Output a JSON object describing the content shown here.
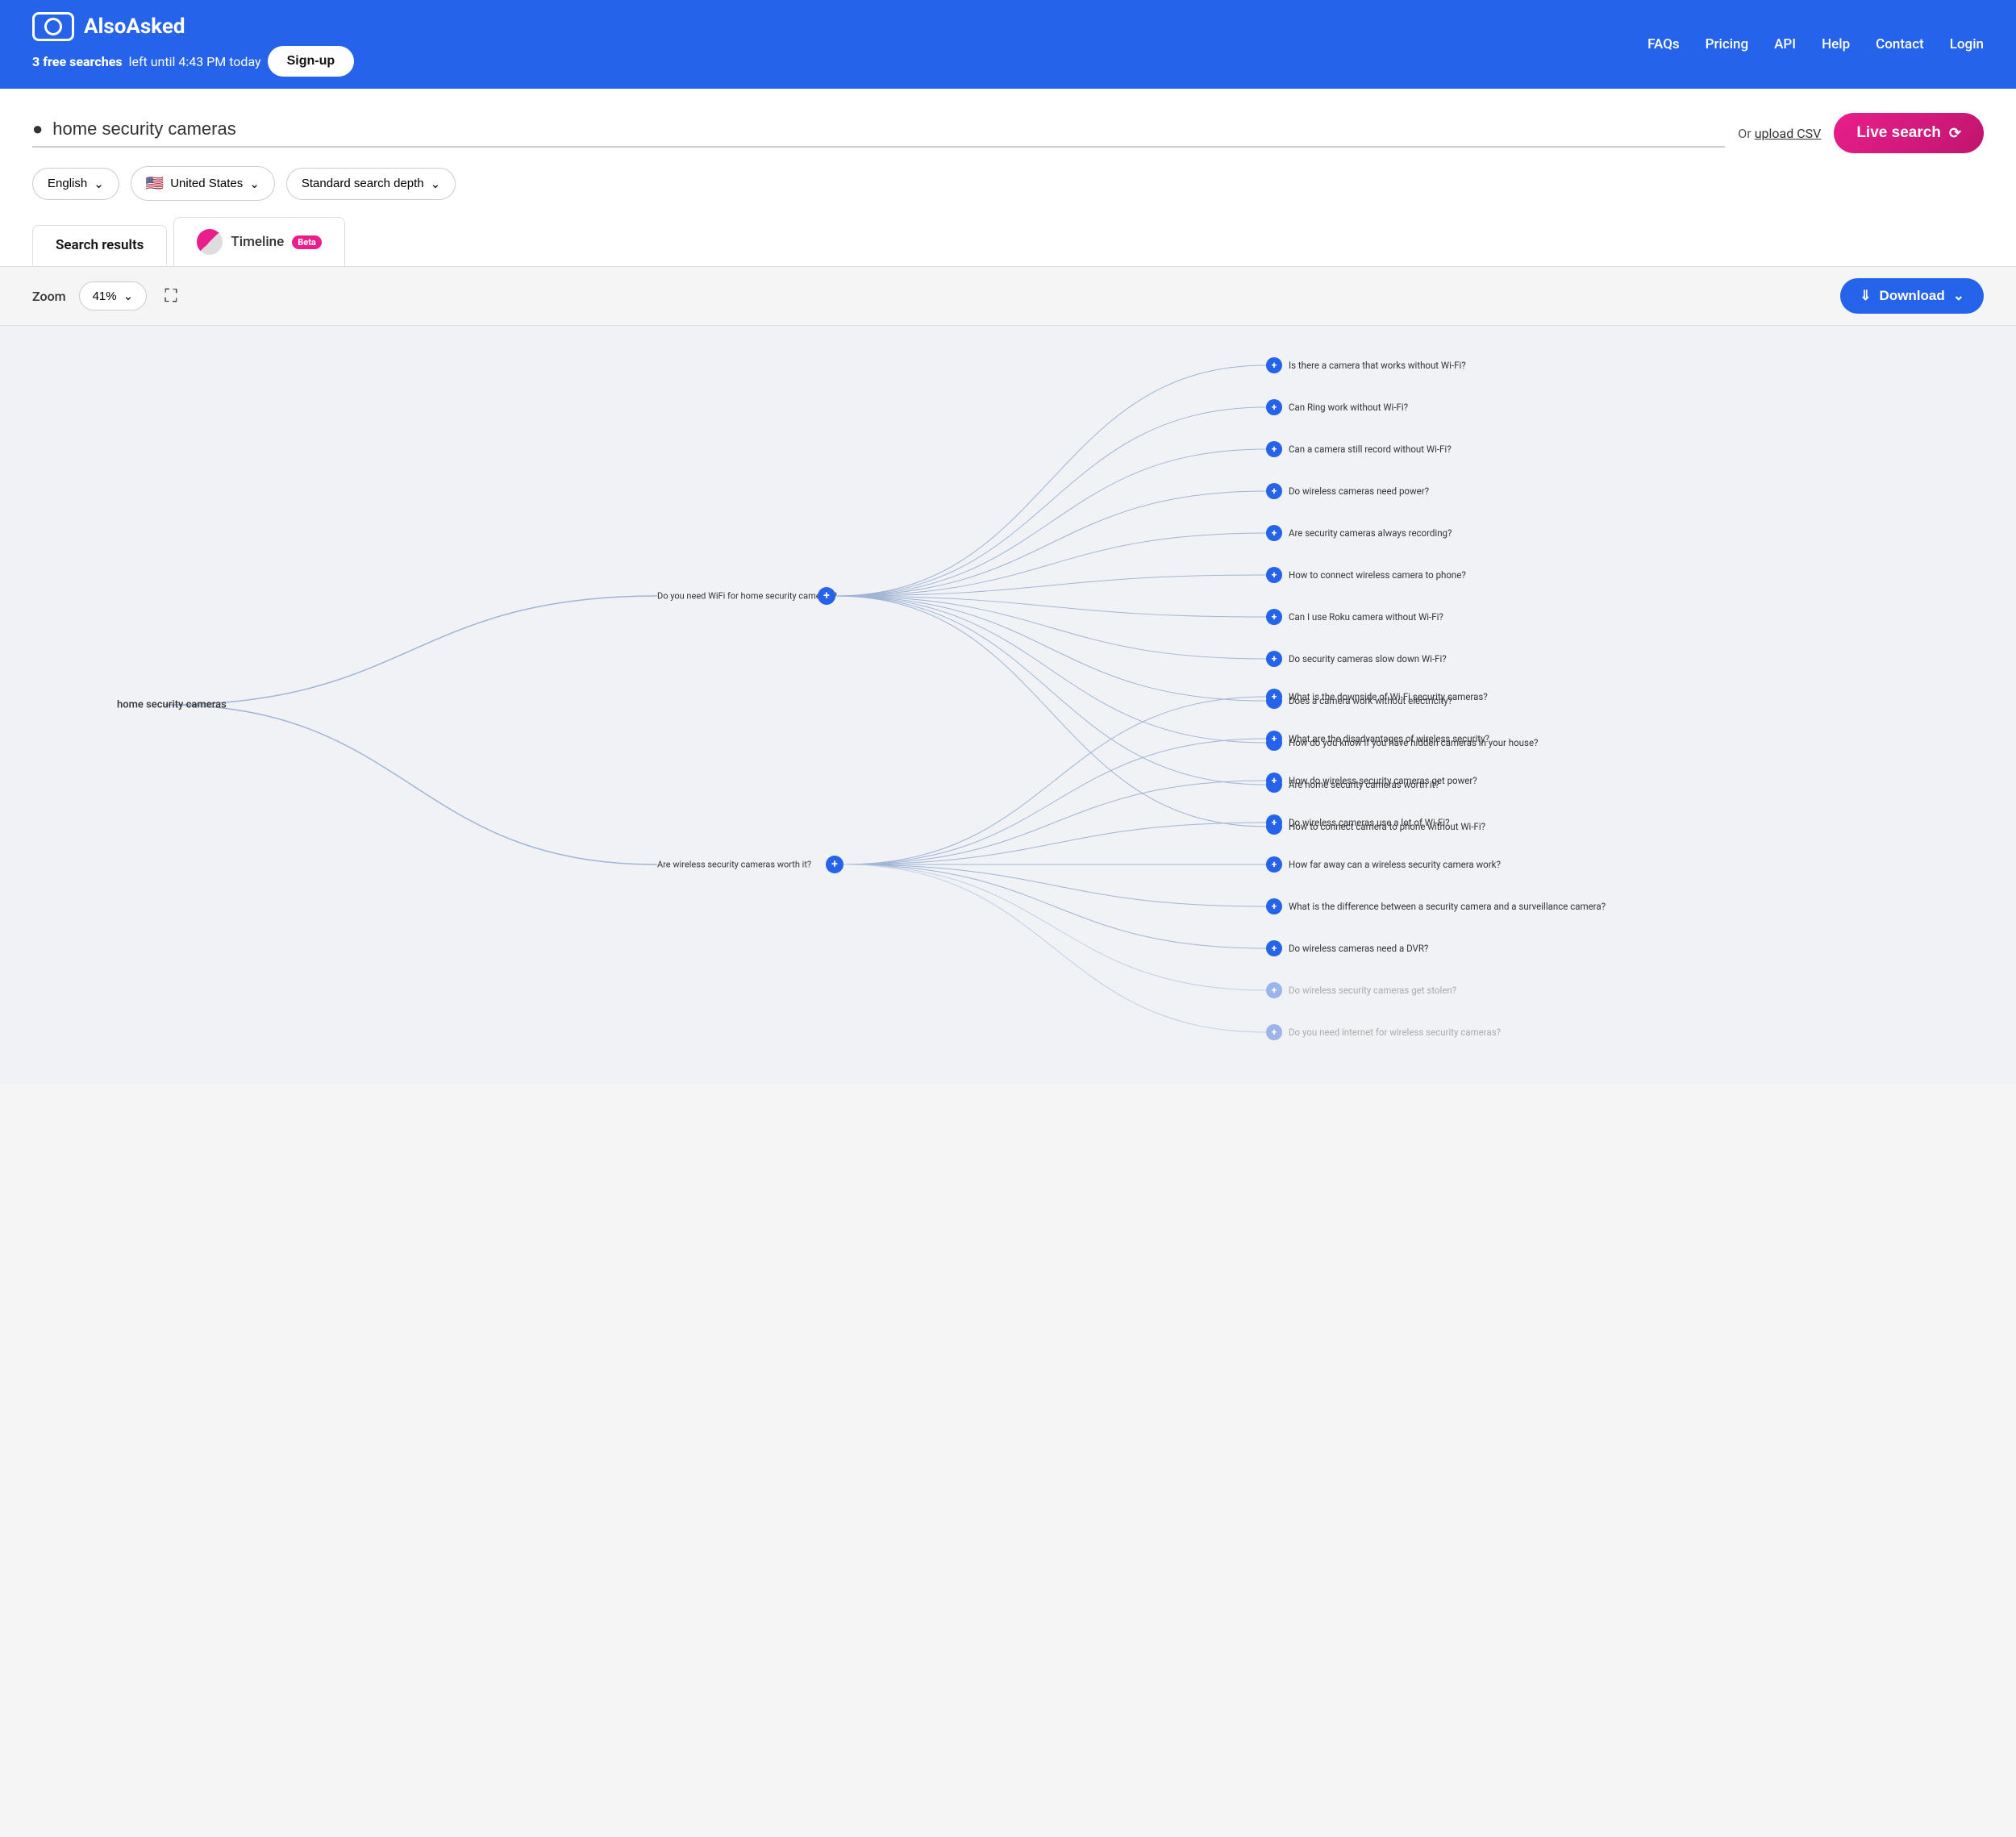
{
  "header": {
    "logo_text": "AlsoAsked",
    "free_searches": "3 free searches",
    "free_searches_suffix": " left until 4:43 PM today",
    "signup_label": "Sign-up",
    "nav": [
      {
        "label": "FAQs",
        "href": "#"
      },
      {
        "label": "Pricing",
        "href": "#"
      },
      {
        "label": "API",
        "href": "#"
      },
      {
        "label": "Help",
        "href": "#"
      },
      {
        "label": "Contact",
        "href": "#"
      },
      {
        "label": "Login",
        "href": "#"
      }
    ]
  },
  "search": {
    "query": "home security cameras",
    "upload_csv_prefix": "Or ",
    "upload_csv_label": "upload CSV",
    "live_search_label": "Live search",
    "language": "English",
    "region": "United States",
    "depth": "Standard search depth"
  },
  "tabs": [
    {
      "label": "Search results",
      "active": true
    },
    {
      "label": "Timeline",
      "beta": true,
      "active": false
    }
  ],
  "toolbar": {
    "zoom_label": "Zoom",
    "zoom_value": "41%",
    "download_label": "Download"
  },
  "tree": {
    "root": "home security cameras",
    "branches": [
      {
        "label": "Do you need WiFi for home security cameras?",
        "leaves": [
          "Is there a camera that works without Wi-Fi?",
          "Can Ring work without Wi-Fi?",
          "Can a camera still record without Wi-Fi?",
          "Do wireless cameras need power?",
          "Are security cameras always recording?",
          "How to connect wireless camera to phone?",
          "Can I use Roku camera without Wi-Fi?",
          "Do security cameras slow down Wi-Fi?",
          "Does a camera work without electricity?",
          "How do you know if you have hidden cameras in your house?",
          "Are home security cameras worth it?",
          "How to connect camera to phone without Wi-Fi?"
        ]
      },
      {
        "label": "Are wireless security cameras worth it?",
        "leaves": [
          "What is the downside of Wi-Fi security cameras?",
          "What are the disadvantages of wireless security?",
          "How do wireless security cameras get power?",
          "Do wireless cameras use a lot of Wi-Fi?",
          "How far away can a wireless security camera work?",
          "What is the difference between a security camera and a surveillance camera?",
          "Do wireless cameras need a DVR?",
          "Do wireless security cameras get stolen?",
          "Do you need internet for wireless security cameras?"
        ],
        "dimmed_from": 7
      }
    ]
  }
}
